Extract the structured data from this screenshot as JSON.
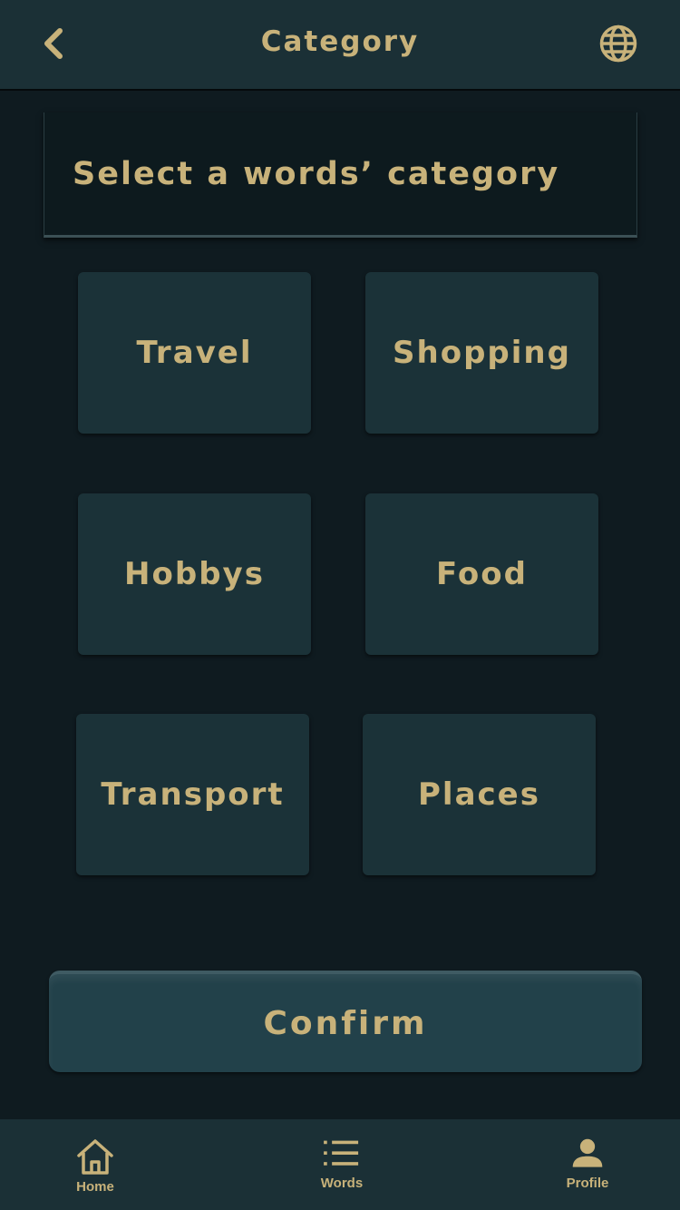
{
  "header": {
    "title": "Category",
    "back_icon": "chevron-left-icon",
    "language_icon": "globe-icon"
  },
  "prompt": {
    "text": "Select a words’ category"
  },
  "categories": [
    {
      "label": "Travel"
    },
    {
      "label": "Shopping"
    },
    {
      "label": "Hobbys"
    },
    {
      "label": "Food"
    },
    {
      "label": "Transport"
    },
    {
      "label": "Places"
    }
  ],
  "confirm": {
    "label": "Confirm"
  },
  "nav": {
    "items": [
      {
        "label": "Home",
        "icon": "home-icon"
      },
      {
        "label": "Words",
        "icon": "list-icon"
      },
      {
        "label": "Profile",
        "icon": "user-icon"
      }
    ]
  },
  "colors": {
    "background": "#0f1b20",
    "bar": "#1b3036",
    "tile": "#1b3238",
    "button": "#22414a",
    "accent_text": "#c8b27a"
  }
}
